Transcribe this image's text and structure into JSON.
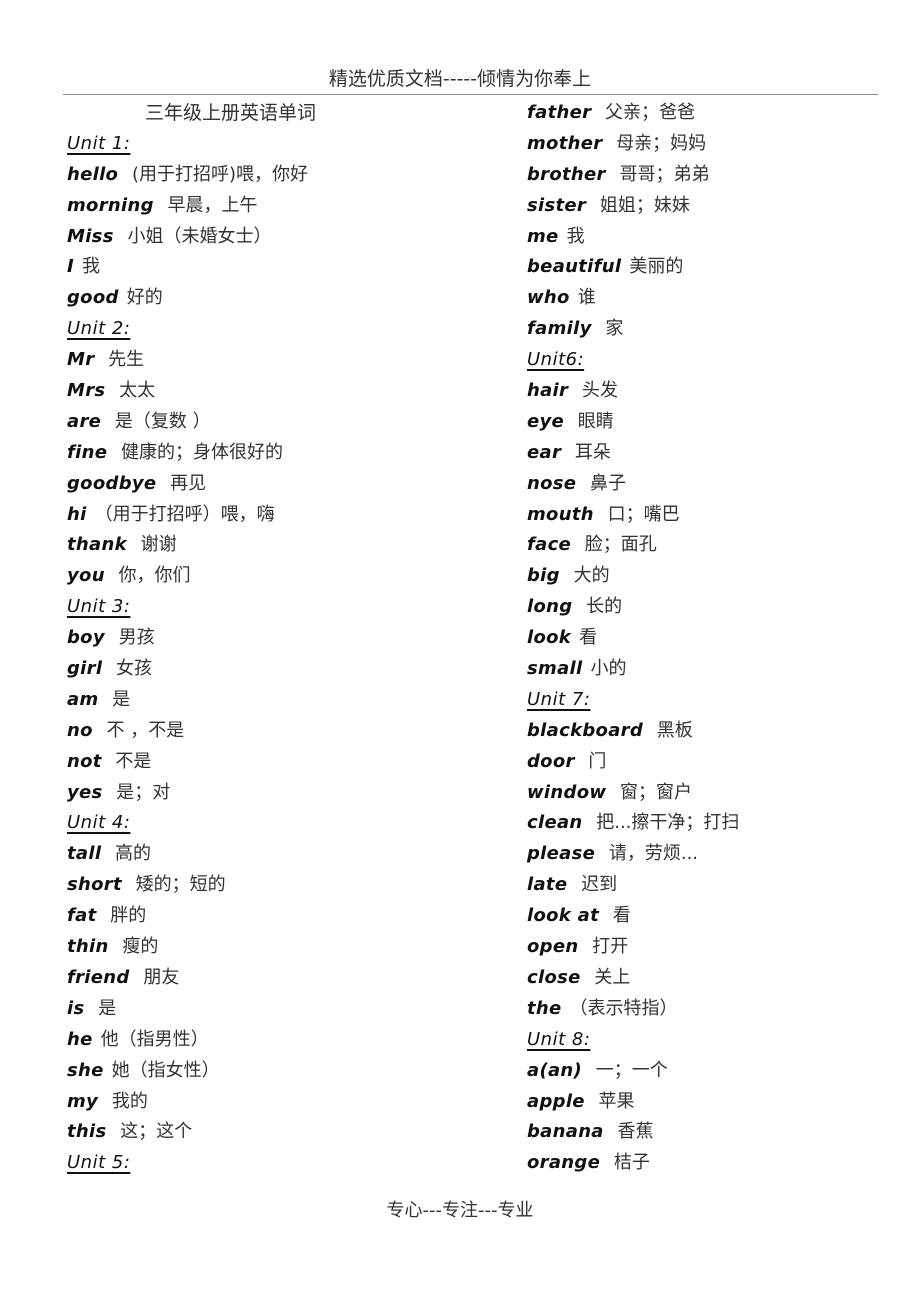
{
  "header": {
    "text": "精选优质文档-----倾情为你奉上"
  },
  "footer": {
    "text": "专心---专注---专业"
  },
  "left_column": [
    {
      "type": "title",
      "text": "三年级上册英语单词"
    },
    {
      "type": "unit",
      "text": "Unit 1: "
    },
    {
      "type": "entry",
      "word": "hello",
      "meaning": " (用于打招呼)喂，你好"
    },
    {
      "type": "entry",
      "word": "morning",
      "meaning": " 早晨，上午"
    },
    {
      "type": "entry",
      "word": "Miss",
      "meaning": " 小姐（未婚女士）"
    },
    {
      "type": "entry",
      "word": "I",
      "meaning": "我"
    },
    {
      "type": "entry",
      "word": "good",
      "meaning": "好的"
    },
    {
      "type": "unit",
      "text": "Unit 2: "
    },
    {
      "type": "entry",
      "word": "Mr",
      "meaning": " 先生"
    },
    {
      "type": "entry",
      "word": "Mrs",
      "meaning": " 太太"
    },
    {
      "type": "entry",
      "word": "are",
      "meaning": " 是（复数 ）"
    },
    {
      "type": "entry",
      "word": "fine",
      "meaning": " 健康的；身体很好的"
    },
    {
      "type": "entry",
      "word": "goodbye",
      "meaning": " 再见"
    },
    {
      "type": "entry",
      "word": "hi",
      "meaning": "（用于打招呼）喂，嗨"
    },
    {
      "type": "entry",
      "word": "thank",
      "meaning": " 谢谢"
    },
    {
      "type": "entry",
      "word": "you",
      "meaning": " 你，你们"
    },
    {
      "type": "unit",
      "text": "Unit 3: "
    },
    {
      "type": "entry",
      "word": "boy",
      "meaning": " 男孩"
    },
    {
      "type": "entry",
      "word": "girl",
      "meaning": " 女孩"
    },
    {
      "type": "entry",
      "word": "am",
      "meaning": " 是"
    },
    {
      "type": "entry",
      "word": "no",
      "meaning": " 不 ，不是"
    },
    {
      "type": "entry",
      "word": "not",
      "meaning": " 不是"
    },
    {
      "type": "entry",
      "word": "yes",
      "meaning": " 是；对"
    },
    {
      "type": "unit",
      "text": "Unit 4: "
    },
    {
      "type": "entry",
      "word": "tall",
      "meaning": " 高的"
    },
    {
      "type": "entry",
      "word": "short",
      "meaning": " 矮的；短的"
    },
    {
      "type": "entry",
      "word": "fat",
      "meaning": " 胖的"
    },
    {
      "type": "entry",
      "word": "thin",
      "meaning": " 瘦的"
    },
    {
      "type": "entry",
      "word": "friend",
      "meaning": " 朋友"
    },
    {
      "type": "entry",
      "word": "is",
      "meaning": " 是"
    },
    {
      "type": "entry",
      "word": "he",
      "meaning": "他（指男性）"
    },
    {
      "type": "entry",
      "word": "she",
      "meaning": "她（指女性）"
    },
    {
      "type": "entry",
      "word": "my",
      "meaning": " 我的"
    },
    {
      "type": "entry",
      "word": "this",
      "meaning": " 这；这个"
    },
    {
      "type": "unit",
      "text": "Unit 5: "
    }
  ],
  "right_column": [
    {
      "type": "entry",
      "word": "father",
      "meaning": " 父亲；爸爸"
    },
    {
      "type": "entry",
      "word": "mother",
      "meaning": " 母亲；妈妈"
    },
    {
      "type": "entry",
      "word": "brother",
      "meaning": " 哥哥；弟弟"
    },
    {
      "type": "entry",
      "word": "sister",
      "meaning": " 姐姐；妹妹"
    },
    {
      "type": "entry",
      "word": "me",
      "meaning": "我"
    },
    {
      "type": "entry",
      "word": "beautiful",
      "meaning": "美丽的"
    },
    {
      "type": "entry",
      "word": "who",
      "meaning": "谁"
    },
    {
      "type": "entry",
      "word": "family",
      "meaning": " 家"
    },
    {
      "type": "unit",
      "text": "Unit6: "
    },
    {
      "type": "entry",
      "word": "hair",
      "meaning": " 头发"
    },
    {
      "type": "entry",
      "word": "eye",
      "meaning": " 眼睛"
    },
    {
      "type": "entry",
      "word": "ear",
      "meaning": " 耳朵"
    },
    {
      "type": "entry",
      "word": "nose",
      "meaning": " 鼻子"
    },
    {
      "type": "entry",
      "word": "mouth",
      "meaning": " 口；嘴巴"
    },
    {
      "type": "entry",
      "word": "face",
      "meaning": " 脸；面孔"
    },
    {
      "type": "entry",
      "word": "big",
      "meaning": " 大的"
    },
    {
      "type": "entry",
      "word": "long",
      "meaning": " 长的"
    },
    {
      "type": "entry",
      "word": "look",
      "meaning": "看"
    },
    {
      "type": "entry",
      "word": "small",
      "meaning": "小的"
    },
    {
      "type": "unit",
      "text": "Unit 7: "
    },
    {
      "type": "entry",
      "word": "blackboard",
      "meaning": " 黑板"
    },
    {
      "type": "entry",
      "word": "door",
      "meaning": " 门"
    },
    {
      "type": "entry",
      "word": "window",
      "meaning": " 窗；窗户"
    },
    {
      "type": "entry",
      "word": "clean",
      "meaning": " 把...擦干净；打扫"
    },
    {
      "type": "entry",
      "word": "please",
      "meaning": " 请，劳烦..."
    },
    {
      "type": "entry",
      "word": "late",
      "meaning": " 迟到"
    },
    {
      "type": "entry",
      "word": "look at",
      "meaning": " 看"
    },
    {
      "type": "entry",
      "word": "open",
      "meaning": " 打开"
    },
    {
      "type": "entry",
      "word": "close",
      "meaning": " 关上"
    },
    {
      "type": "entry",
      "word": "the",
      "meaning": "（表示特指）"
    },
    {
      "type": "unit",
      "text": "Unit 8: "
    },
    {
      "type": "entry",
      "word": "a(an)",
      "meaning": " 一；一个"
    },
    {
      "type": "entry",
      "word": "apple",
      "meaning": " 苹果"
    },
    {
      "type": "entry",
      "word": "banana",
      "meaning": " 香蕉"
    },
    {
      "type": "entry",
      "word": "orange",
      "meaning": " 桔子"
    }
  ]
}
